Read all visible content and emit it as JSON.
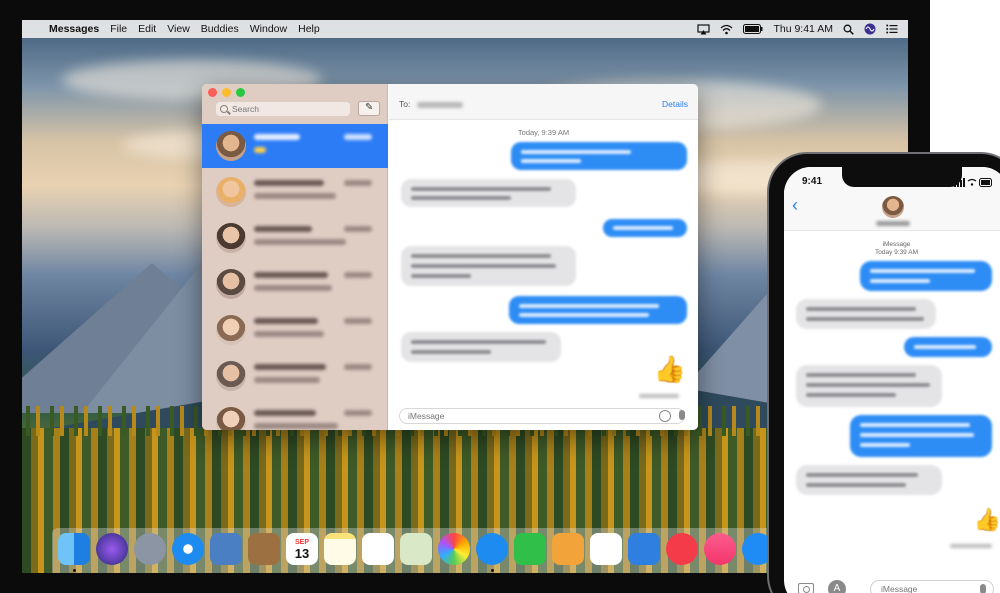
{
  "menubar": {
    "app_name": "Messages",
    "items": [
      "File",
      "Edit",
      "View",
      "Buddies",
      "Window",
      "Help"
    ],
    "clock": "Thu 9:41 AM"
  },
  "messages_window": {
    "search_placeholder": "Search",
    "to_label": "To:",
    "details_label": "Details",
    "timestamp": "Today, 9:39 AM",
    "compose_placeholder": "iMessage",
    "thumbs_up": "👍"
  },
  "dock": {
    "calendar_month": "SEP",
    "calendar_day": "13"
  },
  "phone": {
    "time": "9:41",
    "back_glyph": "‹",
    "service_label": "iMessage",
    "timestamp": "Today 9:39 AM",
    "compose_placeholder": "iMessage",
    "thumbs_up": "👍",
    "apps_glyph": "A"
  },
  "colors": {
    "accent_blue": "#2c7cf6",
    "bubble_gray": "#e4e4e6",
    "bubble_blue": "#2d8df5"
  }
}
